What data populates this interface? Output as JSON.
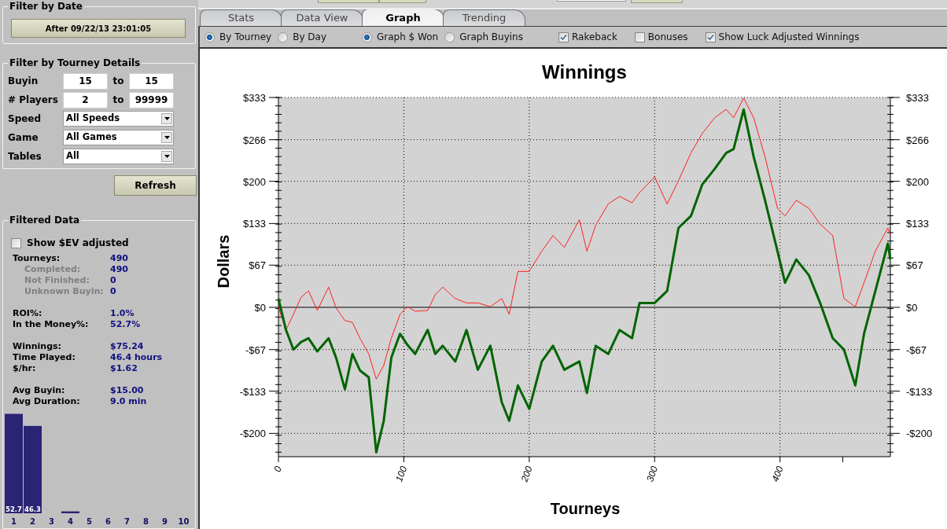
{
  "sidebar": {
    "date_filter": {
      "title": "Filter by Date",
      "button": "After 09/22/13 23:01:05"
    },
    "tourney_filter": {
      "title": "Filter by Tourney Details",
      "fields": [
        {
          "kind": "range",
          "label": "Buyin",
          "from": "15",
          "separator": "to",
          "to": "15"
        },
        {
          "kind": "range",
          "label": "# Players",
          "from": "2",
          "separator": "to",
          "to": "99999"
        },
        {
          "kind": "select",
          "label": "Speed",
          "value": "All Speeds"
        },
        {
          "kind": "select",
          "label": "Game",
          "value": "All Games"
        },
        {
          "kind": "select",
          "label": "Tables",
          "value": "All"
        }
      ]
    },
    "refresh_button": "Refresh",
    "filtered_data": {
      "title": "Filtered Data",
      "ev_checkbox": {
        "label": "Show $EV adjusted",
        "checked": false
      },
      "groups": [
        [
          {
            "kind": "main",
            "label": "Tourneys:",
            "value": "490"
          },
          {
            "kind": "sub",
            "label": "Completed:",
            "value": "490"
          },
          {
            "kind": "sub",
            "label": "Not Finished:",
            "value": "0"
          },
          {
            "kind": "sub",
            "label": "Unknown Buyin:",
            "value": "0"
          }
        ],
        [
          {
            "kind": "main",
            "label": "ROI%:",
            "value": "1.0%"
          },
          {
            "kind": "main",
            "label": "In the Money%:",
            "value": "52.7%"
          }
        ],
        [
          {
            "kind": "main",
            "label": "Winnings:",
            "value": "$75.24"
          },
          {
            "kind": "main",
            "label": "Time Played:",
            "value": "46.4 hours"
          },
          {
            "kind": "main",
            "label": "$/hr:",
            "value": "$1.62"
          }
        ],
        [
          {
            "kind": "main",
            "label": "Avg Buyin:",
            "value": "$15.00"
          },
          {
            "kind": "main",
            "label": "Avg Duration:",
            "value": "9.0 min"
          }
        ]
      ],
      "chart_data": {
        "type": "bar",
        "categories": [
          "1",
          "2",
          "3",
          "4",
          "5",
          "6",
          "7",
          "8",
          "9",
          "10"
        ],
        "values": [
          52.7,
          46.3,
          0,
          1,
          0,
          0,
          0,
          0,
          0,
          0
        ],
        "value_labels": [
          "52.7",
          "46.3",
          null,
          null,
          null,
          null,
          null,
          null,
          null,
          null
        ]
      }
    }
  },
  "tabs": [
    {
      "label": "Stats",
      "selected": false
    },
    {
      "label": "Data View",
      "selected": false
    },
    {
      "label": "Graph",
      "selected": true
    },
    {
      "label": "Trending",
      "selected": false
    }
  ],
  "view_mode": [
    {
      "label": "By Tourney",
      "selected": true
    },
    {
      "label": "By Day",
      "selected": false
    }
  ],
  "graph_type": [
    {
      "label": "Graph $ Won",
      "selected": true
    },
    {
      "label": "Graph Buyins",
      "selected": false
    }
  ],
  "options": [
    {
      "label": "Rakeback",
      "checked": true
    },
    {
      "label": "Bonuses",
      "checked": false
    },
    {
      "label": "Show Luck Adjusted Winnings",
      "checked": true
    }
  ],
  "chart": {
    "chart_data": {
      "type": "line",
      "title": "Winnings",
      "xlabel": "Tourneys",
      "ylabel": "Dollars",
      "x": [
        0,
        6,
        12,
        18,
        24,
        31,
        40,
        46,
        53,
        59,
        65,
        72,
        78,
        84,
        90,
        97,
        103,
        109,
        119,
        125,
        131,
        141,
        150,
        159,
        169,
        178,
        184,
        191,
        200,
        210,
        219,
        228,
        240,
        246,
        253,
        263,
        272,
        282,
        288,
        300,
        310,
        319,
        329,
        338,
        348,
        357,
        363,
        371,
        379,
        388,
        398,
        404,
        413,
        423,
        432,
        442,
        451,
        460,
        467,
        476,
        486,
        488
      ],
      "series": [
        {
          "color": "#ff2020",
          "values": [
            0,
            -36,
            -11,
            16,
            26,
            -5,
            32,
            -1,
            -21,
            -24,
            -49,
            -74,
            -114,
            -92,
            -49,
            -11,
            1,
            -6,
            -5,
            20,
            32,
            14,
            7,
            7,
            1,
            14,
            -11,
            57,
            57,
            89,
            114,
            95,
            139,
            89,
            130,
            164,
            176,
            166,
            182,
            207,
            164,
            201,
            245,
            276,
            301,
            314,
            301,
            332,
            301,
            239,
            157,
            145,
            170,
            157,
            132,
            114,
            14,
            1,
            39,
            89,
            126,
            114
          ]
        },
        {
          "color": "#006400",
          "values": [
            14,
            -36,
            -67,
            -55,
            -49,
            -70,
            -49,
            -80,
            -130,
            -74,
            -100,
            -111,
            -230,
            -180,
            -80,
            -42,
            -60,
            -74,
            -36,
            -74,
            -61,
            -86,
            -36,
            -99,
            -61,
            -150,
            -180,
            -124,
            -161,
            -86,
            -61,
            -99,
            -86,
            -136,
            -61,
            -74,
            -36,
            -49,
            7,
            7,
            26,
            126,
            145,
            195,
            220,
            245,
            251,
            314,
            239,
            170,
            89,
            39,
            76,
            51,
            7,
            -49,
            -67,
            -124,
            -42,
            26,
            101,
            76
          ]
        }
      ],
      "grid": true,
      "xlim": [
        0,
        488
      ],
      "ylim": [
        -237,
        333
      ],
      "xticks": [
        0,
        100,
        200,
        300,
        400
      ],
      "yticks": [
        {
          "value": 333,
          "label": "$333"
        },
        {
          "value": 266,
          "label": "$266"
        },
        {
          "value": 200,
          "label": "$200"
        },
        {
          "value": 133,
          "label": "$133"
        },
        {
          "value": 67,
          "label": "$67"
        },
        {
          "value": 0,
          "label": "$0"
        },
        {
          "value": -67,
          "label": "-$67"
        },
        {
          "value": -133,
          "label": "-$133"
        },
        {
          "value": -200,
          "label": "-$200"
        }
      ]
    }
  }
}
